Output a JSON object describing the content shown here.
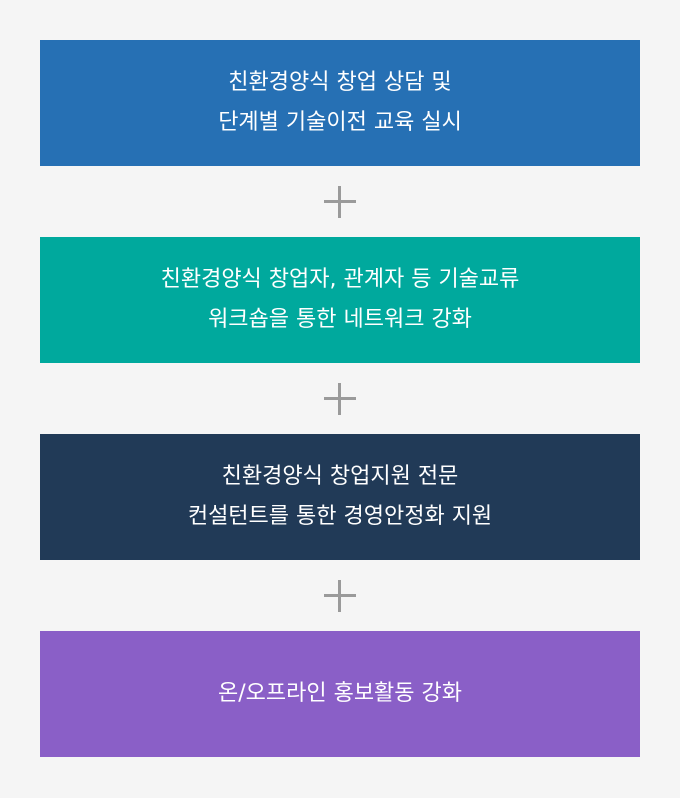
{
  "steps": [
    {
      "lines": [
        "친환경양식 창업 상담 및",
        "단계별 기술이전 교육 실시"
      ],
      "color": "#2670b4"
    },
    {
      "lines": [
        "친환경양식 창업자, 관계자 등 기술교류",
        "워크숍을 통한  네트워크 강화"
      ],
      "color": "#00a99d"
    },
    {
      "lines": [
        "친환경양식 창업지원 전문",
        "컨설턴트를 통한 경영안정화 지원"
      ],
      "color": "#213a57"
    },
    {
      "lines": [
        "온/오프라인 홍보활동 강화"
      ],
      "color": "#8a5fc7"
    }
  ],
  "connector_icon": "plus-icon"
}
